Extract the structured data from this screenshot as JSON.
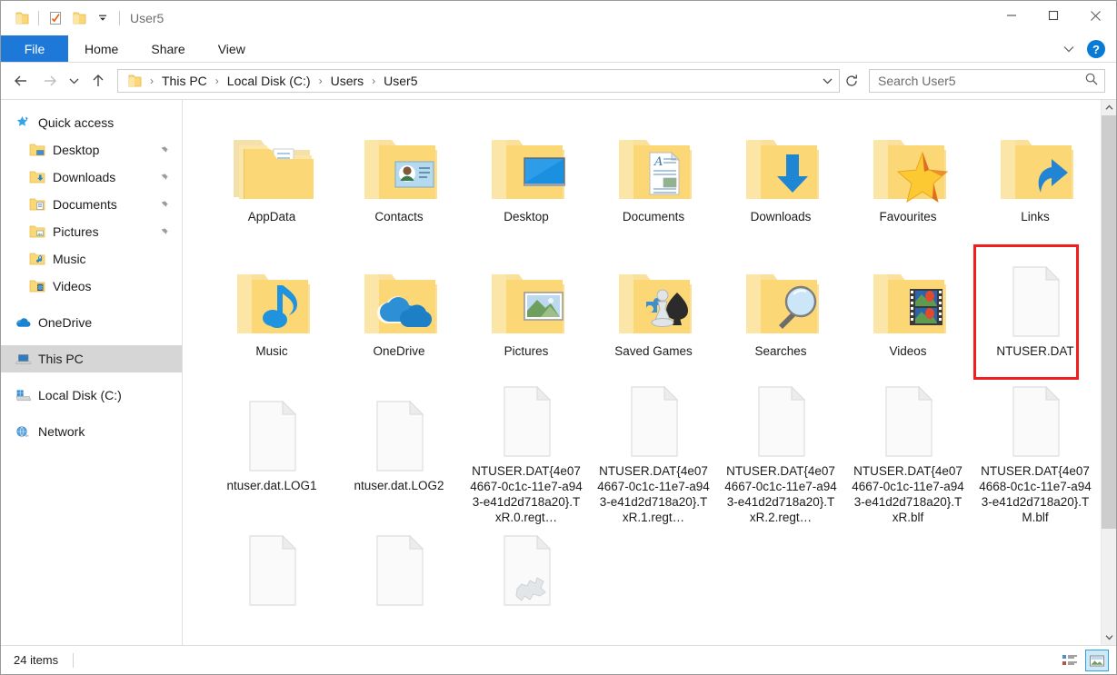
{
  "window": {
    "title": "User5",
    "quick_access": [
      {
        "name": "folder-icon",
        "label": "Folder"
      },
      {
        "name": "properties-icon",
        "label": "Properties"
      },
      {
        "name": "new-folder-icon",
        "label": "New folder"
      },
      {
        "name": "customize-dropdown-icon",
        "label": "Customize Quick Access Toolbar"
      }
    ],
    "controls": {
      "minimize": "Minimize",
      "maximize": "Maximize",
      "close": "Close",
      "collapse_ribbon": "Minimize the Ribbon",
      "help": "?"
    }
  },
  "ribbon": {
    "tabs": [
      {
        "label": "File",
        "active": true
      },
      {
        "label": "Home",
        "active": false
      },
      {
        "label": "Share",
        "active": false
      },
      {
        "label": "View",
        "active": false
      }
    ]
  },
  "navbar": {
    "back": "Back",
    "forward": "Forward",
    "recent": "Recent locations",
    "up": "Up",
    "breadcrumbs": [
      "This PC",
      "Local Disk (C:)",
      "Users",
      "User5"
    ],
    "dropdown": "Previous Locations",
    "refresh": "Refresh",
    "separator": "›"
  },
  "search": {
    "placeholder": "Search User5",
    "value": "",
    "icon": "search-icon"
  },
  "sidebar": {
    "items": [
      {
        "label": "Quick access",
        "icon": "star-pin-icon",
        "indent": false,
        "pinned": false,
        "selected": false
      },
      {
        "label": "Desktop",
        "icon": "desktop-folder-icon",
        "indent": true,
        "pinned": true,
        "selected": false
      },
      {
        "label": "Downloads",
        "icon": "downloads-folder-icon",
        "indent": true,
        "pinned": true,
        "selected": false
      },
      {
        "label": "Documents",
        "icon": "documents-folder-icon",
        "indent": true,
        "pinned": true,
        "selected": false
      },
      {
        "label": "Pictures",
        "icon": "pictures-folder-icon",
        "indent": true,
        "pinned": true,
        "selected": false
      },
      {
        "label": "Music",
        "icon": "music-folder-icon",
        "indent": true,
        "pinned": false,
        "selected": false
      },
      {
        "label": "Videos",
        "icon": "videos-folder-icon",
        "indent": true,
        "pinned": false,
        "selected": false
      },
      {
        "label": "OneDrive",
        "icon": "onedrive-cloud-icon",
        "indent": false,
        "pinned": false,
        "selected": false
      },
      {
        "label": "This PC",
        "icon": "this-pc-icon",
        "indent": false,
        "pinned": false,
        "selected": true
      },
      {
        "label": "Local Disk (C:)",
        "icon": "hard-drive-icon",
        "indent": false,
        "pinned": false,
        "selected": false
      },
      {
        "label": "Network",
        "icon": "network-icon",
        "indent": false,
        "pinned": false,
        "selected": false
      }
    ]
  },
  "files": [
    {
      "name": "AppData",
      "type": "folder",
      "overlay": "appdata",
      "highlight": false
    },
    {
      "name": "Contacts",
      "type": "folder",
      "overlay": "contacts",
      "highlight": false
    },
    {
      "name": "Desktop",
      "type": "folder",
      "overlay": "desktop",
      "highlight": false
    },
    {
      "name": "Documents",
      "type": "folder",
      "overlay": "document",
      "highlight": false
    },
    {
      "name": "Downloads",
      "type": "folder",
      "overlay": "download",
      "highlight": false
    },
    {
      "name": "Favourites",
      "type": "folder",
      "overlay": "star",
      "highlight": false
    },
    {
      "name": "Links",
      "type": "folder",
      "overlay": "link",
      "highlight": false
    },
    {
      "name": "Music",
      "type": "folder",
      "overlay": "music",
      "highlight": false
    },
    {
      "name": "OneDrive",
      "type": "folder",
      "overlay": "cloud",
      "highlight": false
    },
    {
      "name": "Pictures",
      "type": "folder",
      "overlay": "picture",
      "highlight": false
    },
    {
      "name": "Saved Games",
      "type": "folder",
      "overlay": "games",
      "highlight": false
    },
    {
      "name": "Searches",
      "type": "folder",
      "overlay": "magnifier",
      "highlight": false
    },
    {
      "name": "Videos",
      "type": "folder",
      "overlay": "film",
      "highlight": false
    },
    {
      "name": "NTUSER.DAT",
      "type": "file",
      "overlay": "none",
      "highlight": true
    },
    {
      "name": "ntuser.dat.LOG1",
      "type": "file",
      "overlay": "none",
      "highlight": false
    },
    {
      "name": "ntuser.dat.LOG2",
      "type": "file",
      "overlay": "none",
      "highlight": false
    },
    {
      "name": "NTUSER.DAT{4e074667-0c1c-11e7-a943-e41d2d718a20}.TxR.0.regt…",
      "type": "file",
      "overlay": "none",
      "highlight": false
    },
    {
      "name": "NTUSER.DAT{4e074667-0c1c-11e7-a943-e41d2d718a20}.TxR.1.regt…",
      "type": "file",
      "overlay": "none",
      "highlight": false
    },
    {
      "name": "NTUSER.DAT{4e074667-0c1c-11e7-a943-e41d2d718a20}.TxR.2.regt…",
      "type": "file",
      "overlay": "none",
      "highlight": false
    },
    {
      "name": "NTUSER.DAT{4e074667-0c1c-11e7-a943-e41d2d718a20}.TxR.blf",
      "type": "file",
      "overlay": "none",
      "highlight": false
    },
    {
      "name": "NTUSER.DAT{4e074668-0c1c-11e7-a943-e41d2d718a20}.TM.blf",
      "type": "file",
      "overlay": "none",
      "highlight": false
    },
    {
      "name": "",
      "type": "file",
      "overlay": "none",
      "highlight": false
    },
    {
      "name": "",
      "type": "file",
      "overlay": "none",
      "highlight": false
    },
    {
      "name": "",
      "type": "file",
      "overlay": "gear",
      "highlight": false
    }
  ],
  "status": {
    "item_count": "24 items",
    "views": [
      {
        "name": "details-view",
        "active": false
      },
      {
        "name": "large-icons-view",
        "active": true
      }
    ]
  },
  "colors": {
    "accent": "#1e78d7",
    "highlight_box": "#f41c1c",
    "folder": "#fcd775",
    "selected_nav": "#d6d6d6"
  }
}
